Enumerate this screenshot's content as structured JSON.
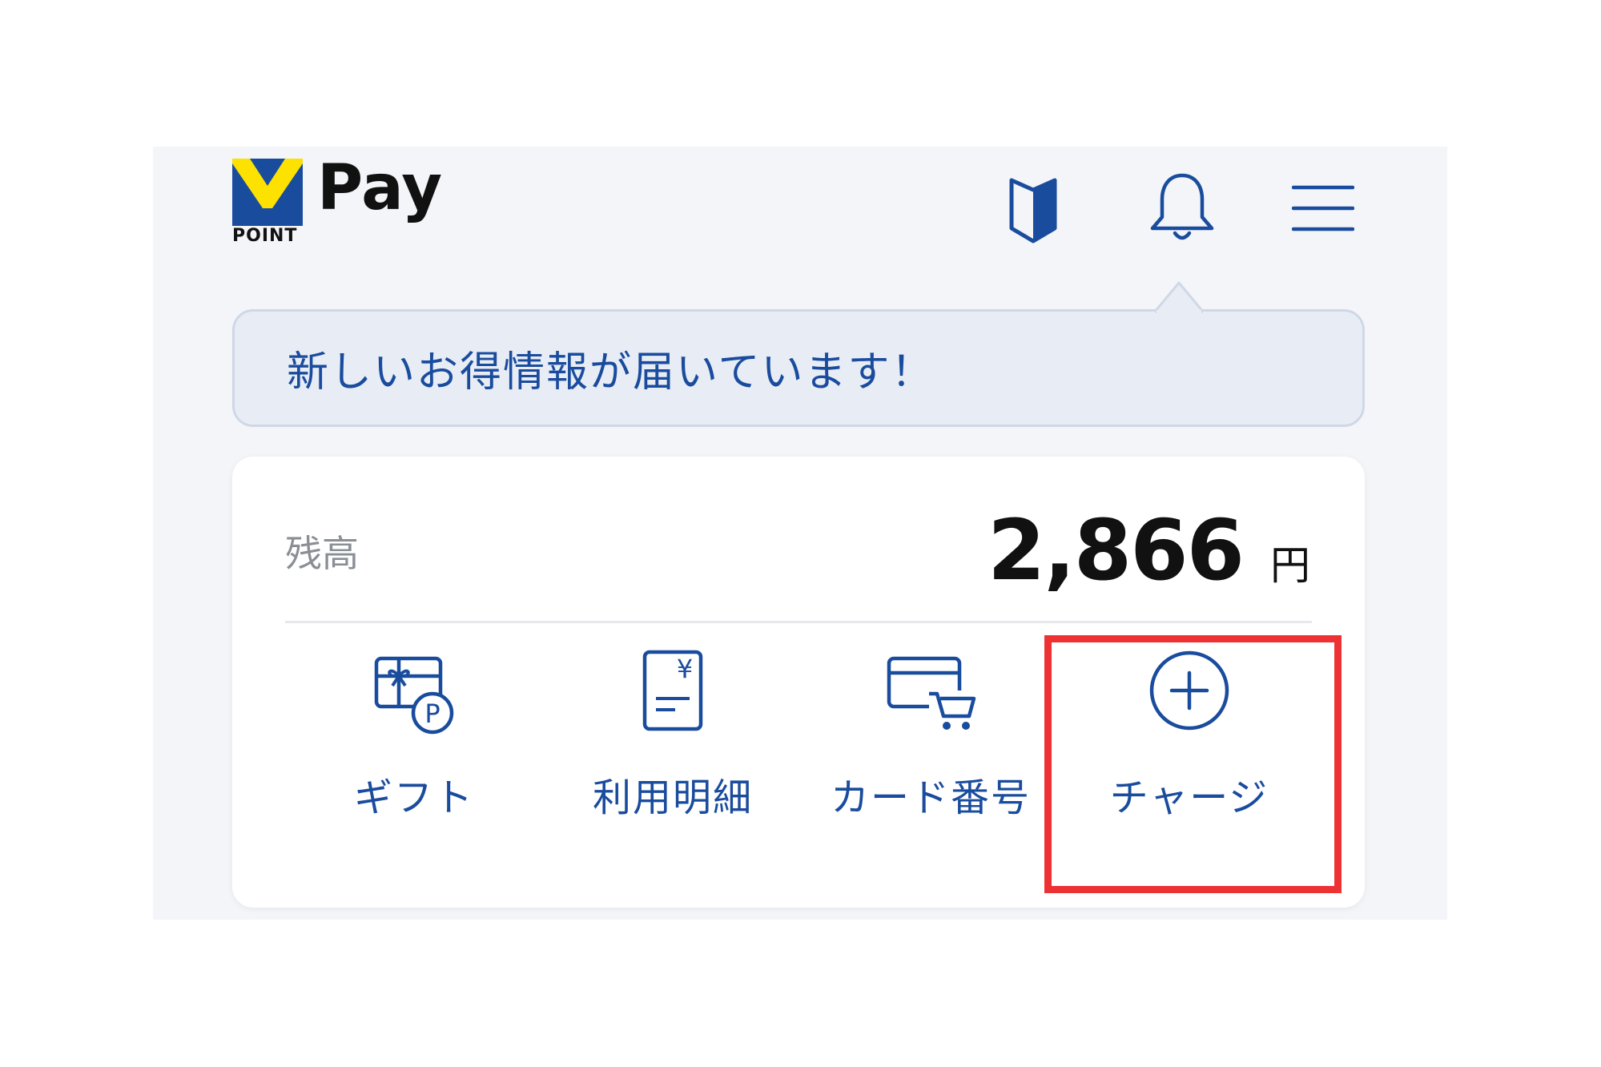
{
  "app": {
    "logo_mark_text": "POINT",
    "logo_name": "Pay",
    "brand_colors": {
      "primary": "#1a4c9e",
      "yellow": "#fde100",
      "highlight": "#ee3234"
    }
  },
  "header": {
    "icons": [
      "guide-book-icon",
      "bell-icon",
      "hamburger-menu-icon"
    ]
  },
  "notice": {
    "text": "新しいお得情報が届いています！"
  },
  "balance": {
    "label": "残高",
    "amount": "2,866",
    "unit": "円"
  },
  "actions": [
    {
      "label": "ギフト",
      "icon": "gift-point-icon"
    },
    {
      "label": "利用明細",
      "icon": "yen-statement-icon"
    },
    {
      "label": "カード番号",
      "icon": "card-cart-icon"
    },
    {
      "label": "チャージ",
      "icon": "plus-circle-icon",
      "highlighted": true
    }
  ]
}
